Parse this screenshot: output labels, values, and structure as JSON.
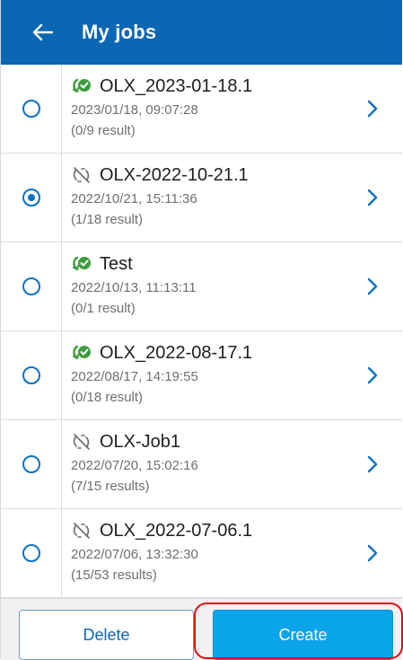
{
  "header": {
    "title": "My jobs",
    "back_icon": "arrow-left-icon",
    "color": "#0b66b3"
  },
  "jobs": [
    {
      "name": "OLX_2023-01-18.1",
      "date": "2023/01/18, 09:07:28",
      "count": "(0/9 result)",
      "status": "synced",
      "selected": false
    },
    {
      "name": "OLX-2022-10-21.1",
      "date": "2022/10/21, 15:11:36",
      "count": "(1/18 result)",
      "status": "not-synced",
      "selected": true
    },
    {
      "name": "Test",
      "date": "2022/10/13, 11:13:11",
      "count": "(0/1 result)",
      "status": "synced",
      "selected": false
    },
    {
      "name": "OLX_2022-08-17.1",
      "date": "2022/08/17, 14:19:55",
      "count": "(0/18 result)",
      "status": "synced",
      "selected": false
    },
    {
      "name": "OLX-Job1",
      "date": "2022/07/20, 15:02:16",
      "count": "(7/15 results)",
      "status": "not-synced",
      "selected": false
    },
    {
      "name": "OLX_2022-07-06.1",
      "date": "2022/07/06, 13:32:30",
      "count": "(15/53 results)",
      "status": "not-synced",
      "selected": false
    }
  ],
  "footer": {
    "delete_label": "Delete",
    "create_label": "Create"
  },
  "colors": {
    "accent": "#0aa4ea",
    "radio": "#0b72c6",
    "sync_green": "#3f9b3f",
    "highlight": "#e01010"
  }
}
